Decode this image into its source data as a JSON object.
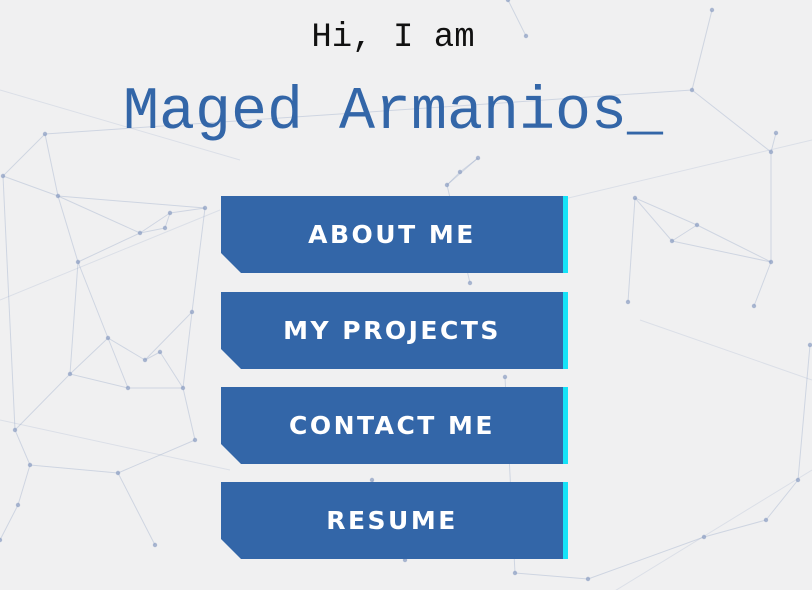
{
  "header": {
    "greeting": "Hi, I am",
    "name": "Maged Armanios_"
  },
  "menu": {
    "about_label": "ABOUT ME",
    "projects_label": "MY PROJECTS",
    "contact_label": "CONTACT ME",
    "resume_label": "RESUME"
  },
  "colors": {
    "accent": "#3366a8",
    "edge_highlight": "#15e3f8",
    "background": "#f0f0f1",
    "network": "#8a9dc2"
  },
  "background": {
    "pattern": "network-lines"
  }
}
